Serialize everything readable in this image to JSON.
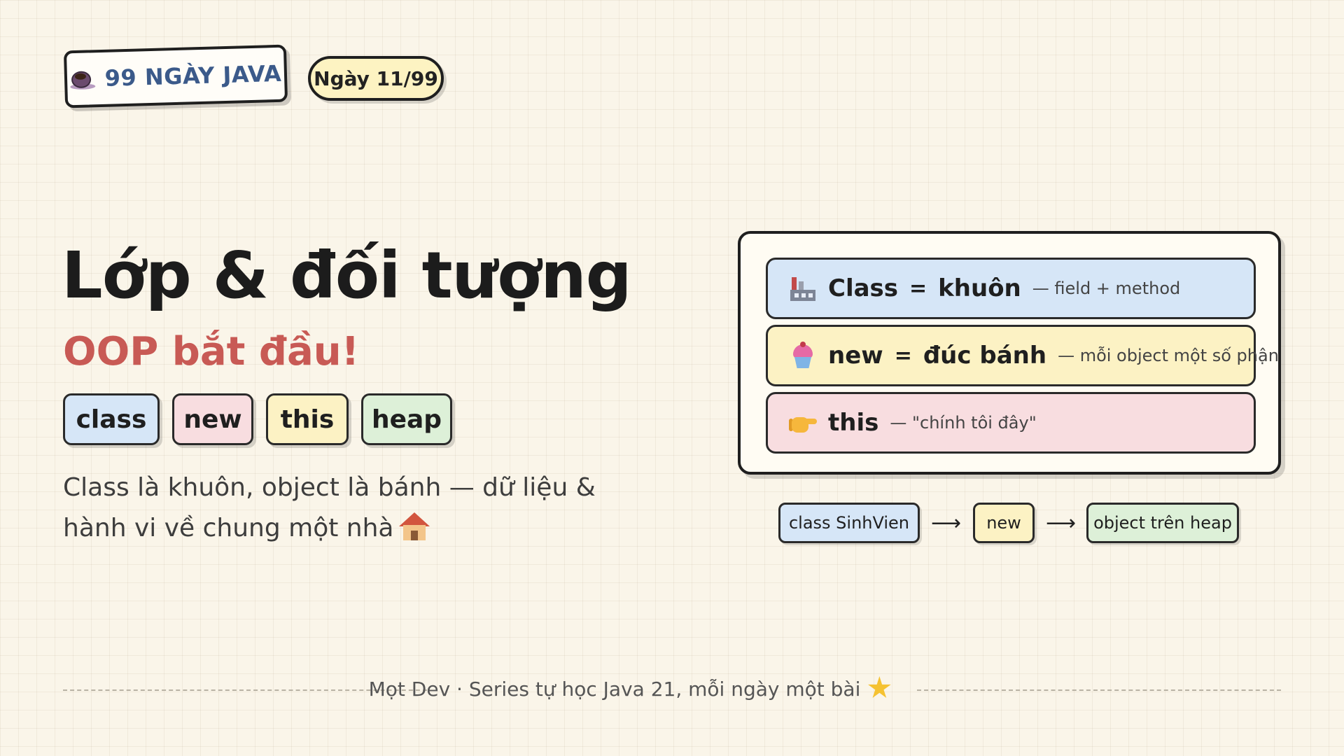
{
  "header": {
    "brand_label": "99 NGÀY JAVA",
    "brand_icon": "coffee-cup-icon",
    "day_label": "Ngày 11/99"
  },
  "hero": {
    "title": "Lớp & đối tượng",
    "subtitle": "OOP bắt đầu!",
    "tags": [
      {
        "label": "class",
        "color": "#d6e6f7"
      },
      {
        "label": "new",
        "color": "#f8dde0"
      },
      {
        "label": "this",
        "color": "#fcf2c4"
      },
      {
        "label": "heap",
        "color": "#ddf0d8"
      }
    ],
    "description": "Class là khuôn, object là bánh — dữ liệu & hành vi về chung một nhà",
    "description_icon": "house-icon"
  },
  "concepts": [
    {
      "icon": "factory-icon",
      "key": "Class",
      "eq": "=",
      "value": "khuôn",
      "note": "— field + method",
      "color": "#d6e6f7"
    },
    {
      "icon": "cupcake-icon",
      "key": "new",
      "eq": "=",
      "value": "đúc bánh",
      "note": "— mỗi object một số phận",
      "color": "#fcf2c4"
    },
    {
      "icon": "pointing-hand-icon",
      "key": "this",
      "eq": "",
      "value": "",
      "note": "— \"chính tôi đây\"",
      "color": "#f8dde0"
    }
  ],
  "flow": {
    "steps": [
      {
        "label": "class SinhVien",
        "color": "#d6e6f7"
      },
      {
        "label": "new",
        "color": "#fcf2c4"
      },
      {
        "label": "object trên heap",
        "color": "#ddf0d8"
      }
    ],
    "arrow": "⟶"
  },
  "footer": {
    "text": "Mọt Dev · Series tự học Java 21, mỗi ngày một bài",
    "icon": "star-icon"
  }
}
